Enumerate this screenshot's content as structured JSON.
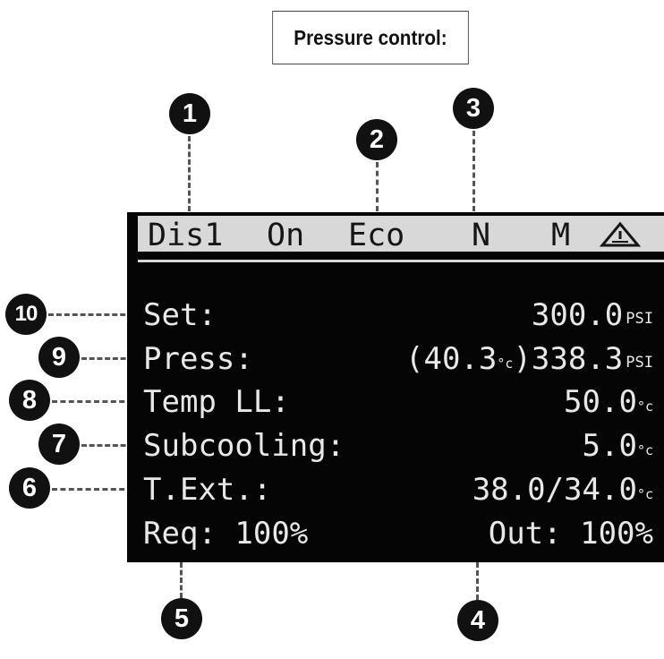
{
  "title": "Pressure control:",
  "status_bar": {
    "circuit": "Dis1",
    "state": "On",
    "mode": "Eco",
    "n_flag": "N",
    "m_flag": "M",
    "warning_icon": "warning-triangle-icon"
  },
  "rows": {
    "set": {
      "label": "Set:",
      "value": "300.0",
      "unit": "PSI"
    },
    "press": {
      "label": "Press:",
      "sat_open": "(40.3",
      "sat_unit": "°c",
      "sat_close": ")",
      "value": "338.3",
      "unit": "PSI"
    },
    "temp_ll": {
      "label": "Temp LL:",
      "value": "50.0",
      "unit": "°c"
    },
    "subcooling": {
      "label": "Subcooling:",
      "value": "5.0",
      "unit": "°c"
    },
    "text": {
      "label": "T.Ext.:",
      "value": "38.0/34.0",
      "unit": "°c"
    },
    "req_out": {
      "req_label": "Req:",
      "req_value": "100%",
      "out_label": "Out:",
      "out_value": "100%"
    }
  },
  "callouts": [
    "1",
    "2",
    "3",
    "4",
    "5",
    "6",
    "7",
    "8",
    "9",
    "10"
  ]
}
